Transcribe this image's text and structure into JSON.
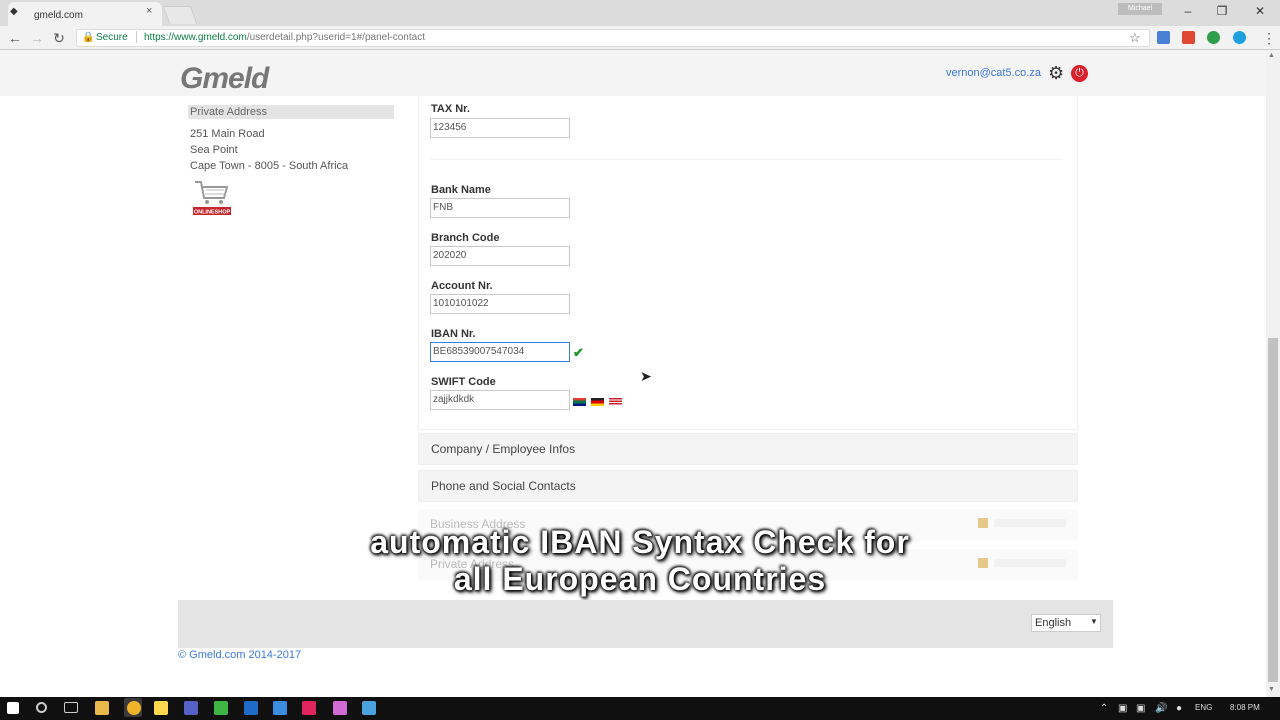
{
  "browser": {
    "tab_title": "gmeld.com",
    "tab_close": "×",
    "user_badge": "Michael",
    "security_label": "Secure",
    "url_host": "https://www.gmeld.com",
    "url_path": "/userdetail.php?userid=1#/panel-contact",
    "window_controls": {
      "minimize": "–",
      "restore": "❐",
      "close": "✕"
    },
    "nav": {
      "back": "←",
      "forward": "→",
      "reload": "↻"
    }
  },
  "header": {
    "logo": "Gmeld",
    "user_email": "vernon@cat5.co.za"
  },
  "sidebar": {
    "private_address_title": "Private Address",
    "address_lines": [
      "251 Main Road",
      "Sea Point",
      "Cape Town - 8005 - South Africa"
    ],
    "shop_label": "ONLINESHOP"
  },
  "form": {
    "tax_label": "TAX Nr.",
    "tax_value": "123456",
    "bank_name_label": "Bank Name",
    "bank_name_value": "FNB",
    "branch_code_label": "Branch Code",
    "branch_code_value": "202020",
    "account_label": "Account Nr.",
    "account_value": "1010101022",
    "iban_label": "IBAN Nr.",
    "iban_value": "BE68539007547034",
    "swift_label": "SWIFT Code",
    "swift_value": "zajjkdkdk",
    "iban_valid_icon": "✔"
  },
  "sections": {
    "company": "Company / Employee Infos",
    "phone": "Phone and Social Contacts",
    "business_address": "Business Address",
    "faint_second": "Private Address"
  },
  "caption": {
    "line1": "automatic IBAN Syntax Check for",
    "line2": "all European Countries"
  },
  "footer": {
    "language": "English",
    "copyright": "© Gmeld.com 2014-2017"
  },
  "taskbar": {
    "language": "ENG",
    "time": "8:08 PM"
  },
  "colors": {
    "link_blue": "#3c78d8",
    "secure_green": "#0b8043",
    "valid_green": "#1a9a2a",
    "power_red": "#d9202b"
  }
}
